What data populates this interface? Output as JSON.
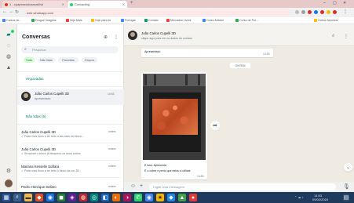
{
  "browser": {
    "tabs": [
      {
        "label": "1 - cpapeacsdcaasat2sd",
        "color": "#d93025"
      },
      {
        "label": "Contacting",
        "color": "#25d366"
      }
    ],
    "new_tab": "+",
    "window_controls": {
      "minimize": "–",
      "maximize": "▢",
      "close": "✕"
    },
    "address": "web.whatsapp.com",
    "bookmarks": [
      {
        "label": "Cursos de...",
        "color": "#4285f4"
      },
      {
        "label": "Drugue Imagens",
        "color": "#34a853"
      },
      {
        "label": "Veja Mais",
        "color": "#ea4335"
      },
      {
        "label": "Hoje para ler",
        "color": "#fbbc05"
      },
      {
        "label": "Portugal",
        "color": "#4285f4"
      },
      {
        "label": "Contato",
        "color": "#0f9d58"
      },
      {
        "label": "Mercados Livres",
        "color": "#ea4335"
      },
      {
        "label": "Curso Adicion",
        "color": "#4285f4"
      },
      {
        "label": "Curso de Pol...",
        "color": "#34a853"
      },
      {
        "label": "Outros favoritos",
        "color": "#fbbc05"
      }
    ]
  },
  "sidebar": {
    "title": "Conversas",
    "search_placeholder": "Pesquisar",
    "filters": [
      {
        "label": "Tudo",
        "active": true
      },
      {
        "label": "Não lidas",
        "active": false
      },
      {
        "label": "Favoritas",
        "active": false
      },
      {
        "label": "Grupos",
        "active": false
      }
    ],
    "archived_label": "Arquivadas",
    "selected_chat": {
      "name": "João Carlos Cupelli 3D",
      "preview": "Apresentado",
      "time": "14:53"
    },
    "unread_label": "Não lidas (5)",
    "chats": [
      {
        "name": "João Carlos Cupelli 3D",
        "preview": "✓ Pode mas ficou a ter feito o seu lado do bloco...",
        "time": "ontem"
      },
      {
        "name": "João Carlos Cupelli 3D",
        "preview": "✓ Se quiser o bloco já bloqueou os seus outros",
        "time": "ontem"
      },
      {
        "name": "Mariana Kesselle Scillara",
        "preview": "✓ Pode mas ficou a ter feito o bloco da cor 3D",
        "time": "ontem"
      },
      {
        "name": "Pedro Henrique Sellaro",
        "preview": "",
        "time": "ontem"
      }
    ]
  },
  "chat": {
    "contact_name": "João Carlos Cupelli 3D",
    "contact_status": "clique aqui para ver os dados do contato",
    "top_message": "Apresentado",
    "top_message_time": "14:53",
    "date_separator": "ONTEM",
    "image_caption": "É isso. Apresenta",
    "image_caption_2": "É o cobre e preto que estou a utilizar",
    "image_time": "14:53",
    "composer_placeholder": "Digite uma mensagem"
  },
  "taskbar": {
    "time": "14:53",
    "date": "09/02/2024"
  },
  "colors": {
    "whatsapp_green": "#25d366",
    "accent_teal": "#008069",
    "chat_background": "#efeae2",
    "taskbar": "#1f3a5c"
  }
}
